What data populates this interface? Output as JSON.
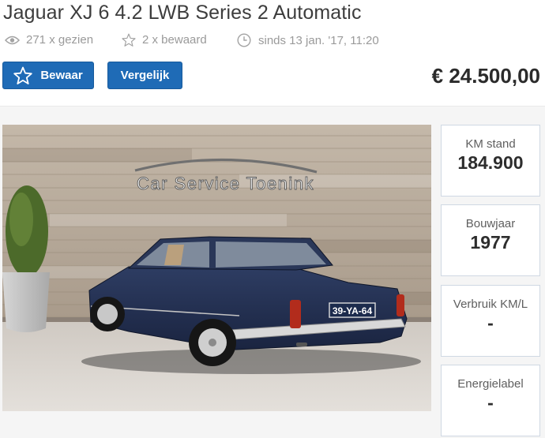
{
  "listing": {
    "title": "Jaguar XJ 6 4.2 LWB Series 2 Automatic",
    "price": "€ 24.500,00"
  },
  "meta": {
    "views": "271 x gezien",
    "saved": "2 x bewaard",
    "date": "sinds 13 jan. '17, 11:20"
  },
  "actions": {
    "save_label": "Bewaar",
    "compare_label": "Vergelijk"
  },
  "photo": {
    "wall_sign_text": "Car Service Toenink",
    "license_plate": "39-YA-64"
  },
  "specs": [
    {
      "label": "KM stand",
      "value": "184.900"
    },
    {
      "label": "Bouwjaar",
      "value": "1977"
    },
    {
      "label": "Verbruik KM/L",
      "value": "-"
    },
    {
      "label": "Energielabel",
      "value": "-"
    }
  ],
  "icons": {
    "views": "eye-icon",
    "saved": "star-outline-icon",
    "date": "clock-icon",
    "save_button": "star-icon"
  },
  "colors": {
    "primary_button": "#1f6bb6",
    "meta_text": "#9a9a9a",
    "spec_border": "#cfd8e3"
  }
}
